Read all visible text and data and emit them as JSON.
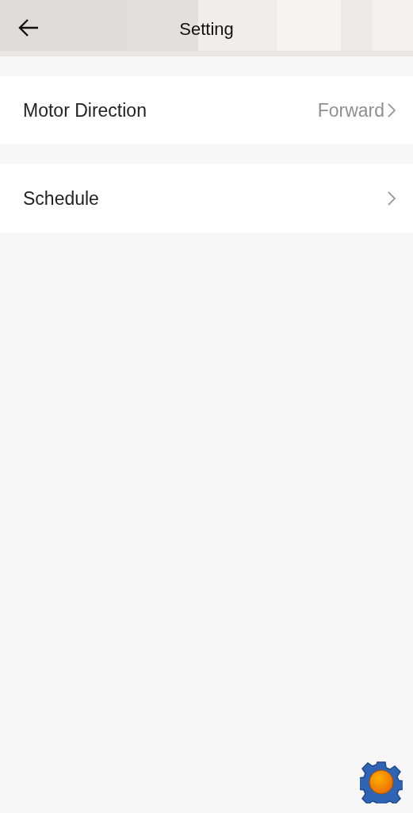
{
  "header": {
    "title": "Setting"
  },
  "settings": [
    {
      "label": "Motor Direction",
      "value": "Forward"
    },
    {
      "label": "Schedule"
    }
  ]
}
